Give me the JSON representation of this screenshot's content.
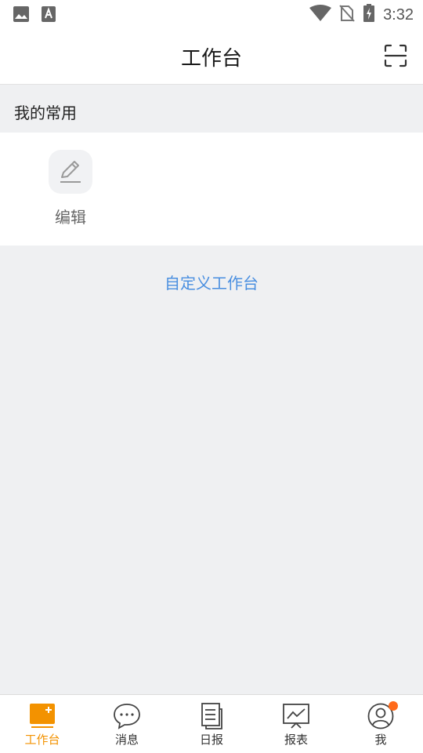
{
  "status_bar": {
    "time": "3:32",
    "icons": [
      "image-icon",
      "font-download-icon",
      "wifi-icon",
      "no-sim-icon",
      "battery-charging-icon"
    ]
  },
  "header": {
    "title": "工作台",
    "scan_icon": "scan-icon"
  },
  "favorites": {
    "section_title": "我的常用",
    "items": [
      {
        "label": "编辑",
        "icon": "pencil-icon"
      }
    ]
  },
  "customize_link": "自定义工作台",
  "tab_bar": {
    "tabs": [
      {
        "label": "工作台",
        "icon": "workbench-icon",
        "active": true
      },
      {
        "label": "消息",
        "icon": "chat-bubble-icon",
        "active": false
      },
      {
        "label": "日报",
        "icon": "daily-report-icon",
        "active": false
      },
      {
        "label": "报表",
        "icon": "chart-board-icon",
        "active": false
      },
      {
        "label": "我",
        "icon": "profile-icon",
        "active": false,
        "badge": true
      }
    ]
  },
  "colors": {
    "accent": "#f39200",
    "link": "#4a8fe0",
    "badge": "#ff6a1a",
    "background": "#eff0f2"
  }
}
